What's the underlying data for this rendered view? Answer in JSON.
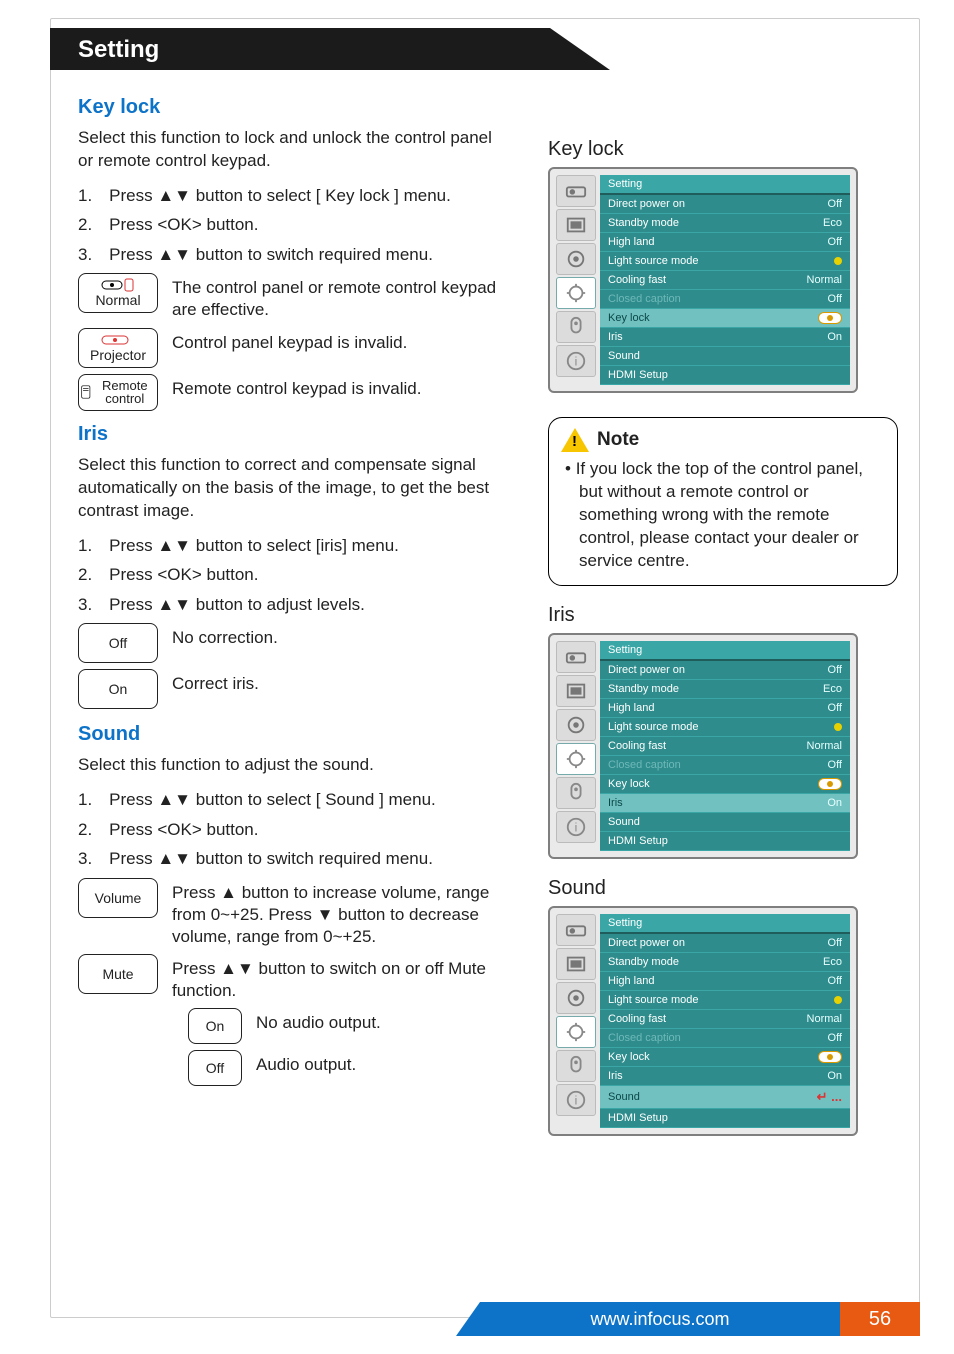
{
  "header": {
    "title": "Setting"
  },
  "sections": {
    "keylock": {
      "heading": "Key lock",
      "intro": "Select this function to lock and unlock the control panel or remote control keypad.",
      "steps": [
        "1. Press ▲▼ button to select [ Key lock ] menu.",
        "2. Press <OK> button.",
        "3. Press ▲▼ button to switch required menu."
      ],
      "options": [
        {
          "label": "Normal",
          "desc": "The control panel or remote control keypad are effective."
        },
        {
          "label": "Projector",
          "desc": "Control panel keypad is invalid."
        },
        {
          "label": "Remote control",
          "desc": "Remote control keypad is invalid."
        }
      ]
    },
    "iris": {
      "heading": "Iris",
      "intro": "Select this function to correct and compensate signal automatically on the basis of the image, to get the best contrast image.",
      "steps": [
        "1. Press ▲▼ button to select [iris] menu.",
        "2. Press <OK> button.",
        "3. Press ▲▼ button to adjust levels."
      ],
      "options": [
        {
          "label": "Off",
          "desc": "No correction."
        },
        {
          "label": "On",
          "desc": "Correct iris."
        }
      ]
    },
    "sound": {
      "heading": "Sound",
      "intro": "Select this function to adjust the sound.",
      "steps": [
        "1. Press ▲▼ button to select [ Sound ] menu.",
        "2. Press <OK> button.",
        "3. Press ▲▼ button to switch required menu."
      ],
      "options": [
        {
          "label": "Volume",
          "desc": "Press ▲ button to increase volume, range from 0~+25. Press ▼ button to decrease volume, range from 0~+25."
        },
        {
          "label": "Mute",
          "desc": "Press ▲▼ button to switch on or off Mute function."
        }
      ],
      "mute_sub": [
        {
          "label": "On",
          "desc": "No audio output."
        },
        {
          "label": "Off",
          "desc": "Audio output."
        }
      ]
    }
  },
  "right": {
    "keylock_title": "Key lock",
    "iris_title": "Iris",
    "sound_title": "Sound",
    "note": {
      "title": "Note",
      "item": "If you lock the top of the control panel, but without a remote control or something wrong with the remote control, please contact your dealer or service centre."
    }
  },
  "osd": {
    "menu_title": "Setting",
    "rows": [
      {
        "label": "Direct power on",
        "value": "Off"
      },
      {
        "label": "Standby mode",
        "value": "Eco"
      },
      {
        "label": "High land",
        "value": "Off"
      },
      {
        "label": "Light source mode",
        "value": "dot"
      },
      {
        "label": "Cooling fast",
        "value": "Normal"
      },
      {
        "label": "Closed caption",
        "value": "Off",
        "dim": true
      },
      {
        "label": "Key lock",
        "value": "key"
      },
      {
        "label": "Iris",
        "value": "On"
      },
      {
        "label": "Sound",
        "value": ""
      },
      {
        "label": "HDMI Setup",
        "value": ""
      }
    ],
    "sound_enter": "↵  ..."
  },
  "footer": {
    "url": "www.infocus.com",
    "page": "56"
  }
}
